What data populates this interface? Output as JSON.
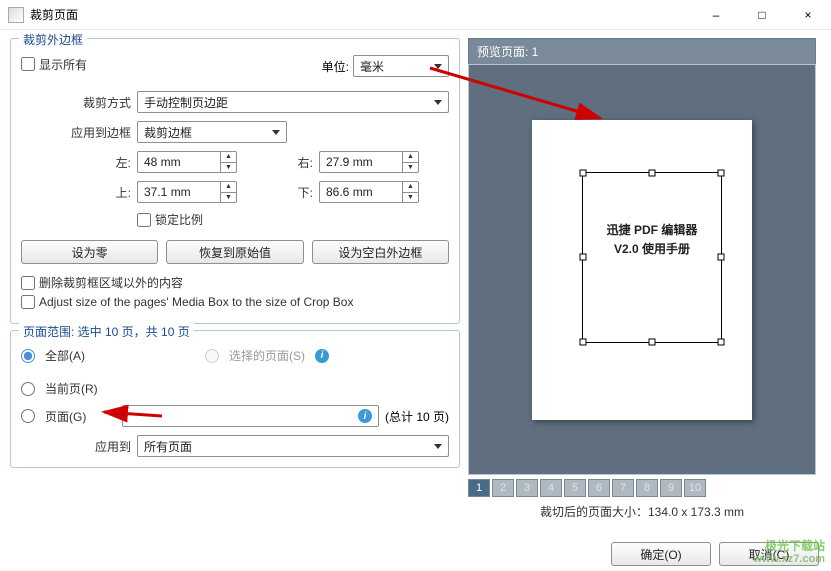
{
  "window": {
    "title": "裁剪页面",
    "minimize": "–",
    "maximize": "□",
    "close": "×"
  },
  "cropbox": {
    "legend": "裁剪外边框",
    "show_all_label": "显示所有",
    "unit_label": "单位:",
    "unit_value": "毫米",
    "crop_mode_label": "裁剪方式",
    "crop_mode_value": "手动控制页边距",
    "apply_border_label": "应用到边框",
    "apply_border_value": "裁剪边框",
    "left_label": "左:",
    "left_value": "48 mm",
    "right_label": "右:",
    "right_value": "27.9 mm",
    "top_label": "上:",
    "top_value": "37.1 mm",
    "bottom_label": "下:",
    "bottom_value": "86.6 mm",
    "lock_ratio_label": "锁定比例",
    "set_zero": "设为零",
    "restore": "恢复到原始值",
    "set_blank": "设为空白外边框",
    "remove_outside_label": "删除裁剪框区域以外的内容",
    "adjust_media_box_label": "Adjust size of the pages' Media Box to the size of Crop Box"
  },
  "pagerange": {
    "legend": "页面范围: 选中 10 页，共 10 页",
    "all_label": "全部(A)",
    "selected_label": "选择的页面(S)",
    "current_label": "当前页(R)",
    "pages_label": "页面(G)",
    "total_label": "(总计 10 页)",
    "apply_to_label": "应用到",
    "apply_to_value": "所有页面"
  },
  "preview": {
    "header": "预览页面: 1",
    "doc_line1": "迅捷 PDF 编辑器",
    "doc_line2": "V2.0 使用手册",
    "pages": [
      "1",
      "2",
      "3",
      "4",
      "5",
      "6",
      "7",
      "8",
      "9",
      "10"
    ],
    "size_label": "裁切后的页面大小：134.0 x 173.3 mm"
  },
  "footer": {
    "ok": "确定(O)",
    "cancel": "取消(C)"
  },
  "watermark": {
    "line1": "极光下载站",
    "line2": "www.xz7.com"
  }
}
